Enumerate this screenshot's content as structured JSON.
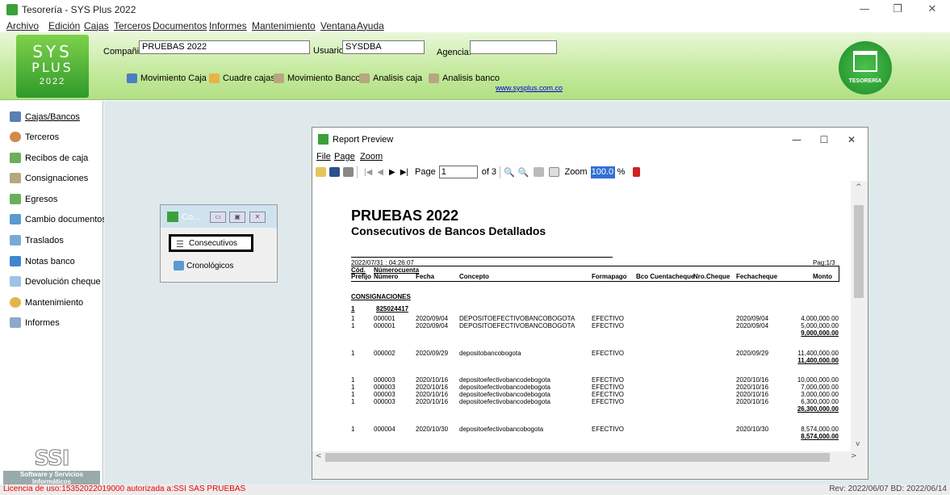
{
  "app": {
    "title": "Tesorería - SYS Plus 2022",
    "window_controls": [
      "—",
      "❐",
      "✕"
    ]
  },
  "menu": [
    "Archivo",
    "Edición",
    "Cajas",
    "Terceros",
    "Documentos",
    "Informes",
    "Mantenimiento",
    "Ventana",
    "Ayuda"
  ],
  "header": {
    "logo_line1": "SYS",
    "logo_line2": "PLUS",
    "logo_year": "2022",
    "compania_label": "Compañia:",
    "compania_value": "PRUEBAS 2022",
    "usuario_label": "Usuario:",
    "usuario_value": "SYSDBA",
    "agencia_label": "Agencia:",
    "agencia_value": "",
    "toolbar": [
      "Movimiento Caja",
      "Cuadre cajas",
      "Movimiento Banco",
      "Analisis caja",
      "Analisis banco"
    ],
    "link": "www.sysplus.com.co",
    "right_logo_text": "TESORERÍA"
  },
  "sidebar": {
    "items": [
      "Cajas/Bancos",
      "Terceros",
      "Recibos de caja",
      "Consignaciones",
      "Egresos",
      "Cambio documentos",
      "Traslados",
      "Notas banco",
      "Devolución cheque",
      "Mantenimiento",
      "Informes"
    ],
    "ssi_mark": "SSI",
    "ssi_line1": "Software y Servicios",
    "ssi_line2": "Informáticos"
  },
  "mini_window": {
    "title": "Co...",
    "item1": "Consecutivos",
    "item2": "Cronológicos"
  },
  "report_preview": {
    "title": "Report Preview",
    "menu": [
      "File",
      "Page",
      "Zoom"
    ],
    "page_label": "Page",
    "page_value": "1",
    "page_of": "of 3",
    "zoom_label": "Zoom",
    "zoom_value": "100.0",
    "zoom_unit": "%"
  },
  "report": {
    "company": "PRUEBAS 2022",
    "subtitle": "Consecutivos de Bancos Detallados",
    "timestamp": "2022/07/31 : 04:26:07",
    "pag": "Pag:1/3",
    "hdr_cod": "Cód.",
    "hdr_numcuenta": "Númerocuenta",
    "hdr_prefijo": "Prefijo",
    "hdr_numero": "Número",
    "hdr_fecha": "Fecha",
    "hdr_concepto": "Concepto",
    "hdr_formapago": "Formapago",
    "hdr_bco": "Bco Cuentacheque",
    "hdr_nrocheque": "Nro.Cheque",
    "hdr_fechacheque": "Fechacheque",
    "hdr_monto": "Monto",
    "section": "CONSIGNACIONES",
    "group_cod": "1",
    "group_cuenta": "825024417",
    "rows": [
      {
        "pref": "1",
        "num": "000001",
        "fecha": "2020/09/04",
        "concepto": "DEPOSITOEFECTIVOBANCOBOGOTA",
        "forma": "EFECTIVO",
        "fchq": "2020/09/04",
        "monto": "4,000,000.00"
      },
      {
        "pref": "1",
        "num": "000001",
        "fecha": "2020/09/04",
        "concepto": "DEPOSITOEFECTIVOBANCOBOGOTA",
        "forma": "EFECTIVO",
        "fchq": "2020/09/04",
        "monto": "5,000,000.00"
      },
      {
        "pref": "1",
        "num": "000002",
        "fecha": "2020/09/29",
        "concepto": "depositobancobogota",
        "forma": "EFECTIVO",
        "fchq": "2020/09/29",
        "monto": "11,400,000.00"
      },
      {
        "pref": "1",
        "num": "000003",
        "fecha": "2020/10/16",
        "concepto": "depositoefectivobancodebogota",
        "forma": "EFECTIVO",
        "fchq": "2020/10/16",
        "monto": "10,000,000.00"
      },
      {
        "pref": "1",
        "num": "000003",
        "fecha": "2020/10/16",
        "concepto": "depositoefectivobancodebogota",
        "forma": "EFECTIVO",
        "fchq": "2020/10/16",
        "monto": "7,000,000.00"
      },
      {
        "pref": "1",
        "num": "000003",
        "fecha": "2020/10/16",
        "concepto": "depositoefectivobancodebogota",
        "forma": "EFECTIVO",
        "fchq": "2020/10/16",
        "monto": "3,000,000.00"
      },
      {
        "pref": "1",
        "num": "000003",
        "fecha": "2020/10/16",
        "concepto": "depositoefectivobancodebogota",
        "forma": "EFECTIVO",
        "fchq": "2020/10/16",
        "monto": "6,300,000.00"
      },
      {
        "pref": "1",
        "num": "000004",
        "fecha": "2020/10/30",
        "concepto": "depositoefectivobancobogota",
        "forma": "EFECTIVO",
        "fchq": "2020/10/30",
        "monto": "8,574,000.00"
      }
    ],
    "subtotals": [
      "9,000,000.00",
      "11,400,000.00",
      "26,300,000.00",
      "8,574,000.00"
    ]
  },
  "status": {
    "license": "Licencia de uso:15352022019000 autorizada a:SSI SAS PRUEBAS",
    "rev": "Rev: 2022/06/07 BD: 2022/06/14"
  },
  "colors": {
    "header_green": "#c4e99c",
    "logo_green": "#2f9a2a",
    "workspace": "#dfe9ec",
    "license_red": "#e00000",
    "link_blue": "#0000cc"
  }
}
